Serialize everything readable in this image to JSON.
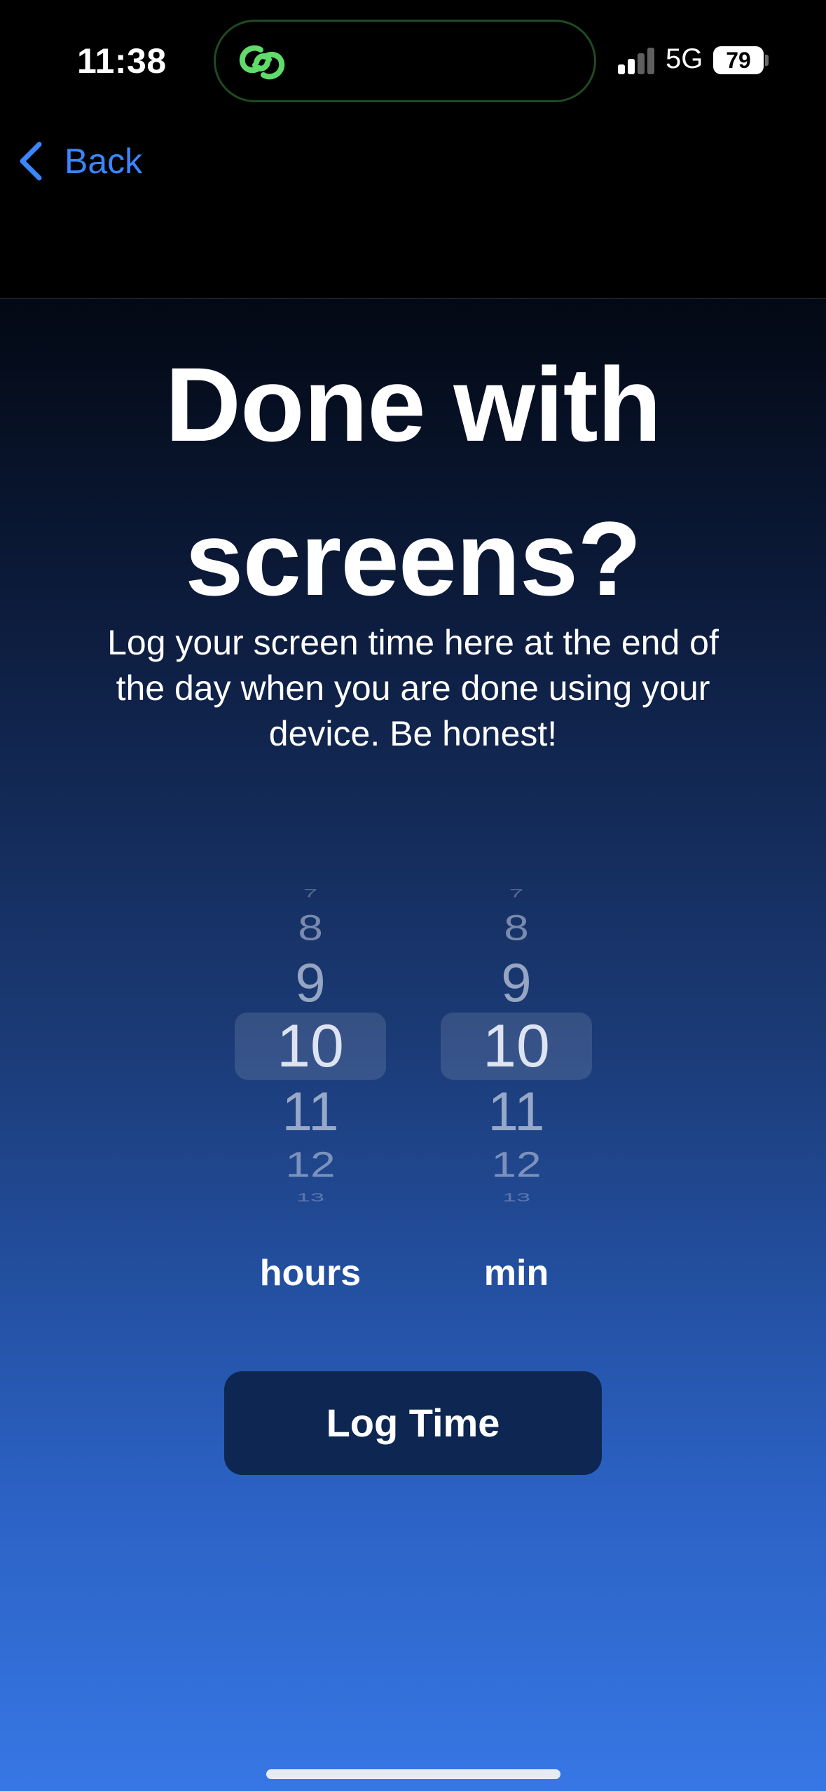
{
  "status_bar": {
    "time": "11:38",
    "network": "5G",
    "battery": "79",
    "island_icon": "link-rings-icon"
  },
  "nav": {
    "back_label": "Back",
    "back_icon": "chevron-left-icon"
  },
  "main": {
    "title": "Done with screens?",
    "subtitle": "Log your screen time here at the end of the day when you are done using your device. Be honest!"
  },
  "hours_picker": {
    "items": [
      "7",
      "8",
      "9",
      "10",
      "11",
      "12",
      "13"
    ],
    "selected": "10",
    "label": "hours"
  },
  "minutes_picker": {
    "items": [
      "7",
      "8",
      "9",
      "10",
      "11",
      "12",
      "13"
    ],
    "selected": "10",
    "label": "min"
  },
  "actions": {
    "log_button": "Log Time"
  },
  "colors": {
    "accent": "#3a86ff",
    "button_bg": "#0d2752",
    "island_icon": "#5fdc6a",
    "gradient_top": "#030914",
    "gradient_bottom": "#3777e5"
  }
}
